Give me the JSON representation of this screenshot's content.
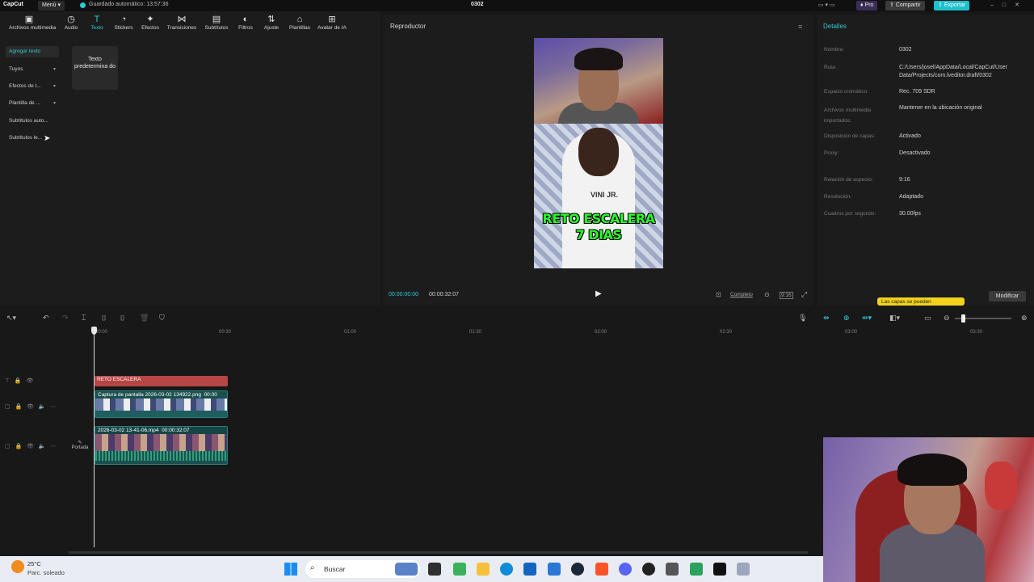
{
  "titlebar": {
    "logo": "CapCut",
    "menu": "Menú",
    "autosave": "Guardado automático: 13:57:36",
    "project": "0302",
    "pro": "Pro",
    "share": "Compartir",
    "export": "Exportar"
  },
  "tools": [
    {
      "label": "Archivos multimedia",
      "icon": "media-icon"
    },
    {
      "label": "Audio",
      "icon": "audio-icon"
    },
    {
      "label": "Texto",
      "icon": "text-icon"
    },
    {
      "label": "Stickers",
      "icon": "sticker-icon"
    },
    {
      "label": "Efectos",
      "icon": "effects-icon"
    },
    {
      "label": "Transiciones",
      "icon": "transitions-icon"
    },
    {
      "label": "Subtítulos",
      "icon": "subtitles-icon"
    },
    {
      "label": "Filtros",
      "icon": "filters-icon"
    },
    {
      "label": "Ajuste",
      "icon": "adjust-icon"
    },
    {
      "label": "Plantillas",
      "icon": "templates-icon"
    },
    {
      "label": "Avatar de IA",
      "icon": "ai-avatar-icon"
    }
  ],
  "sidebar": {
    "items": [
      {
        "label": "Agregar texto"
      },
      {
        "label": "Tuyos"
      },
      {
        "label": "Efectos de t..."
      },
      {
        "label": "Plantilla de ..."
      },
      {
        "label": "Subtítulos auto..."
      },
      {
        "label": "Subtítulos le..."
      }
    ],
    "default_text": "Texto predetermina do"
  },
  "player": {
    "title": "Reproductor",
    "current_time": "00:00:00:00",
    "total_time": "00:00:32:07",
    "overlay_line1": "RETO ESCALERA",
    "overlay_line2": "7 DIAS",
    "jersey": "VINI JR.",
    "full_label": "Completo",
    "ratio": "9:16"
  },
  "details": {
    "title": "Detalles",
    "rows": [
      {
        "label": "Nombre:",
        "value": "0302"
      },
      {
        "label": "Ruta:",
        "value": "C:/Users/josel/AppData/Local/CapCut/User Data/Projects/com.lveditor.draft/0302"
      },
      {
        "label": "Espacio cromático:",
        "value": "Rec. 709 SDR"
      },
      {
        "label": "Archivos multimedia importados:",
        "value": "Mantener en la ubicación original"
      },
      {
        "label": "Disposición de capas:",
        "value": "Activado"
      },
      {
        "label": "Proxy:",
        "value": "Desactivado"
      },
      {
        "label": "Relación de aspecto:",
        "value": "9:16"
      },
      {
        "label": "Resolución:",
        "value": "Adaptado"
      },
      {
        "label": "Cuadros por segundo:",
        "value": "30.00fps"
      }
    ],
    "tooltip": "Las capas se pueden",
    "modify": "Modificar"
  },
  "timeline": {
    "ticks": [
      "00:00",
      "00:30",
      "01:00",
      "01:30",
      "02:00",
      "02:30",
      "03:00",
      "03:30"
    ],
    "text_clip": "RETO ESCALERA",
    "image_clip": "Captura de pantalla 2026-03-02 134922.png",
    "image_clip_dur": "00:00",
    "video_clip": "2026-03-02 13-41-06.mp4",
    "video_clip_dur": "00:00:32:07",
    "cover": "Portada"
  },
  "taskbar": {
    "temp": "25°C",
    "weather": "Parc. soleado",
    "search": "Buscar"
  }
}
